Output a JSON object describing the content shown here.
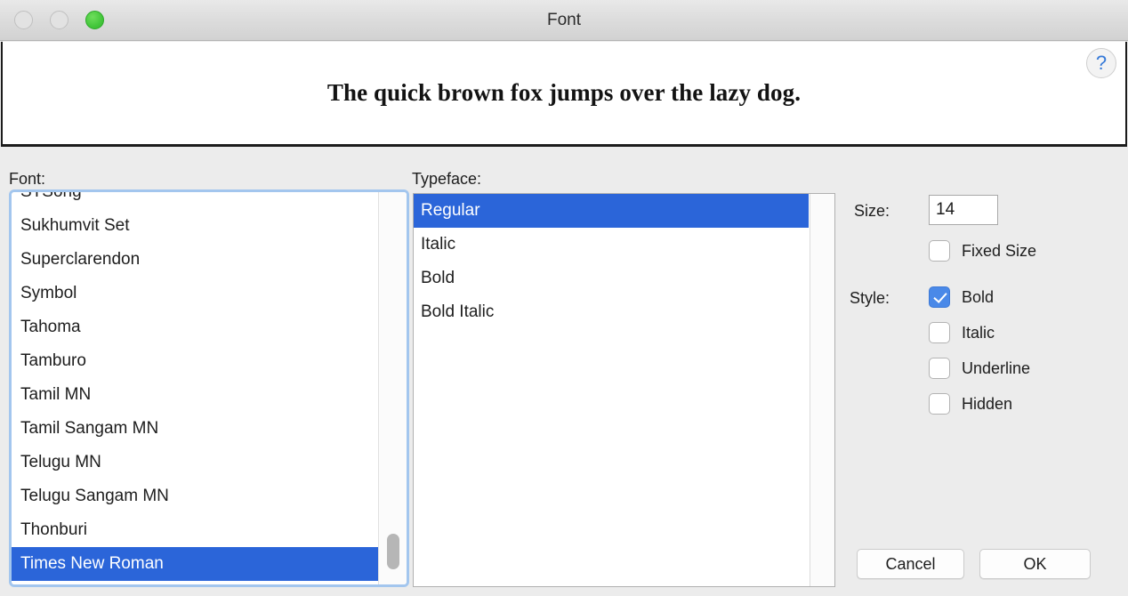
{
  "window": {
    "title": "Font",
    "traffic_lights": [
      {
        "name": "close",
        "state": "disabled"
      },
      {
        "name": "minimize",
        "state": "disabled"
      },
      {
        "name": "zoom",
        "state": "active",
        "color": "#43c63a"
      }
    ]
  },
  "preview": {
    "sample_text": "The quick brown fox jumps over the lazy dog.",
    "help_label": "?"
  },
  "font_section": {
    "label": "Font:",
    "items": [
      "STSong",
      "Sukhumvit Set",
      "Superclarendon",
      "Symbol",
      "Tahoma",
      "Tamburo",
      "Tamil MN",
      "Tamil Sangam MN",
      "Telugu MN",
      "Telugu Sangam MN",
      "Thonburi",
      "Times New Roman"
    ],
    "selected": "Times New Roman",
    "selected_index": 11
  },
  "typeface_section": {
    "label": "Typeface:",
    "items": [
      "Regular",
      "Italic",
      "Bold",
      "Bold Italic"
    ],
    "selected": "Regular",
    "selected_index": 0
  },
  "size_section": {
    "label": "Size:",
    "value": "14",
    "fixed_size": {
      "label": "Fixed Size",
      "checked": false
    }
  },
  "style_section": {
    "label": "Style:",
    "options": [
      {
        "label": "Bold",
        "checked": true
      },
      {
        "label": "Italic",
        "checked": false
      },
      {
        "label": "Underline",
        "checked": false
      },
      {
        "label": "Hidden",
        "checked": false
      }
    ]
  },
  "footer": {
    "cancel_label": "Cancel",
    "ok_label": "OK"
  },
  "colors": {
    "selection_blue": "#2b65d9",
    "checkbox_blue": "#4a89e8",
    "focus_ring": "#a3c6ee",
    "window_bg": "#ececec"
  }
}
